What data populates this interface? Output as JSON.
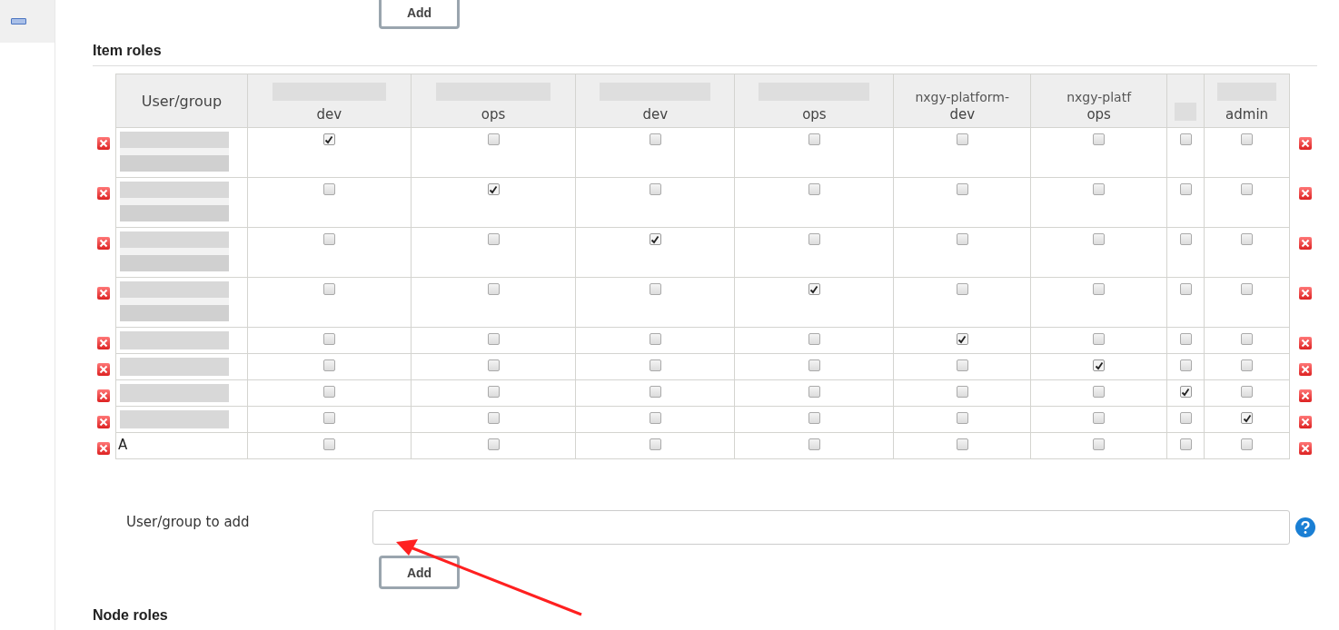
{
  "top_button": "Add",
  "section_title": "Item roles",
  "table": {
    "user_header": "User/group",
    "columns": [
      {
        "label": "dev"
      },
      {
        "label": "ops"
      },
      {
        "label": "dev"
      },
      {
        "label": "ops"
      },
      {
        "top": "nxgy-platform-",
        "label": "dev"
      },
      {
        "top": "nxgy-platf",
        "label": "ops"
      },
      {},
      {
        "label": "admin"
      }
    ],
    "rows": [
      {
        "wrapped": true,
        "checks": [
          true,
          false,
          false,
          false,
          false,
          false,
          false,
          false
        ]
      },
      {
        "wrapped": true,
        "checks": [
          false,
          true,
          false,
          false,
          false,
          false,
          false,
          false
        ]
      },
      {
        "wrapped": true,
        "checks": [
          false,
          false,
          true,
          false,
          false,
          false,
          false,
          false
        ]
      },
      {
        "wrapped": true,
        "checks": [
          false,
          false,
          false,
          true,
          false,
          false,
          false,
          false
        ]
      },
      {
        "wrapped": false,
        "checks": [
          false,
          false,
          false,
          false,
          true,
          false,
          false,
          false
        ]
      },
      {
        "wrapped": false,
        "checks": [
          false,
          false,
          false,
          false,
          false,
          true,
          false,
          false
        ]
      },
      {
        "wrapped": false,
        "checks": [
          false,
          false,
          false,
          false,
          false,
          false,
          true,
          false
        ]
      },
      {
        "wrapped": false,
        "checks": [
          false,
          false,
          false,
          false,
          false,
          false,
          false,
          true
        ]
      },
      {
        "user": "A",
        "wrapped": false,
        "checks": [
          false,
          false,
          false,
          false,
          false,
          false,
          false,
          false
        ]
      }
    ]
  },
  "add_label": "User/group to add",
  "add_button": "Add",
  "next_section": "Node roles"
}
